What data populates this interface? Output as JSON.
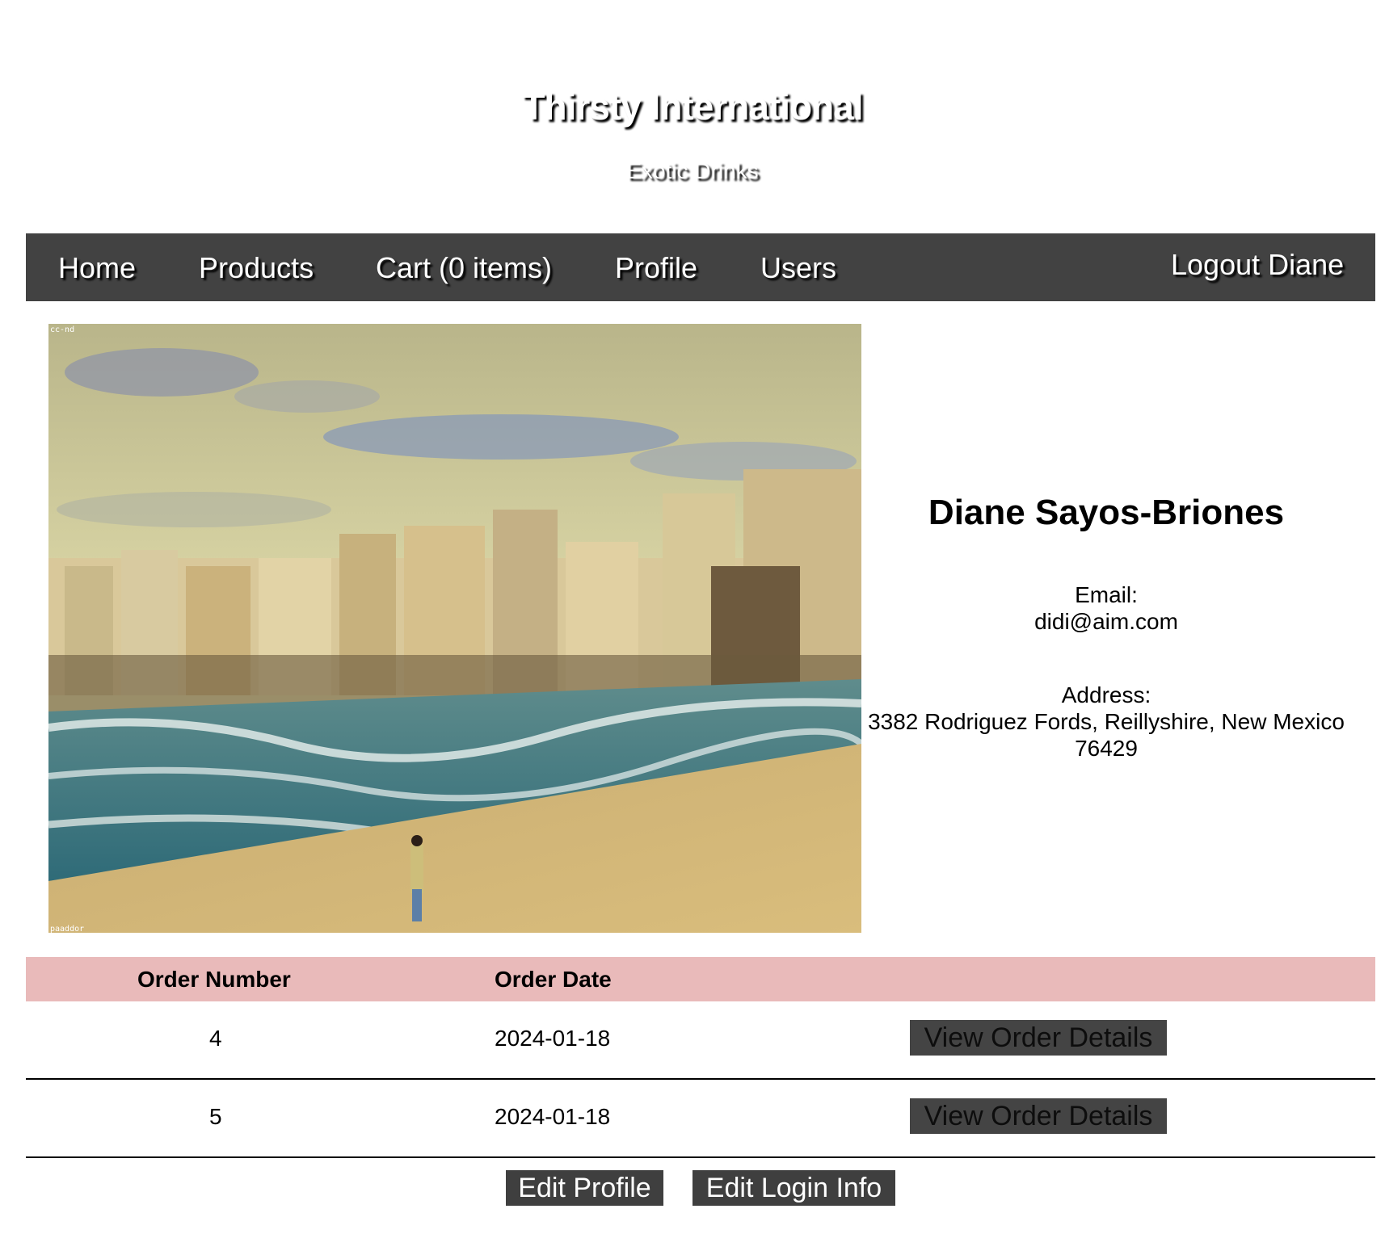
{
  "header": {
    "title": "Thirsty International",
    "tagline": "Exotic Drinks"
  },
  "nav": {
    "items": [
      "Home",
      "Products",
      "Cart (0 items)",
      "Profile",
      "Users"
    ],
    "logout_label": "Logout Diane"
  },
  "photo": {
    "license_mark": "cc-nd",
    "author_mark": "paaddor"
  },
  "profile": {
    "name": "Diane Sayos-Briones",
    "email_label": "Email:",
    "email": "didi@aim.com",
    "address_label": "Address:",
    "address_line1": "3382 Rodriguez Fords, Reillyshire, New Mexico",
    "address_line2": "76429"
  },
  "orders": {
    "headers": [
      "Order Number",
      "Order Date",
      ""
    ],
    "rows": [
      {
        "number": "4",
        "date": "2024-01-18",
        "action": "View Order Details"
      },
      {
        "number": "5",
        "date": "2024-01-18",
        "action": "View Order Details"
      }
    ],
    "header_color": "#e9baba"
  },
  "actions": {
    "edit_profile": "Edit Profile",
    "edit_login": "Edit Login Info"
  },
  "colors": {
    "nav_bg": "#424242",
    "button_bg": "#3f3f3f"
  }
}
